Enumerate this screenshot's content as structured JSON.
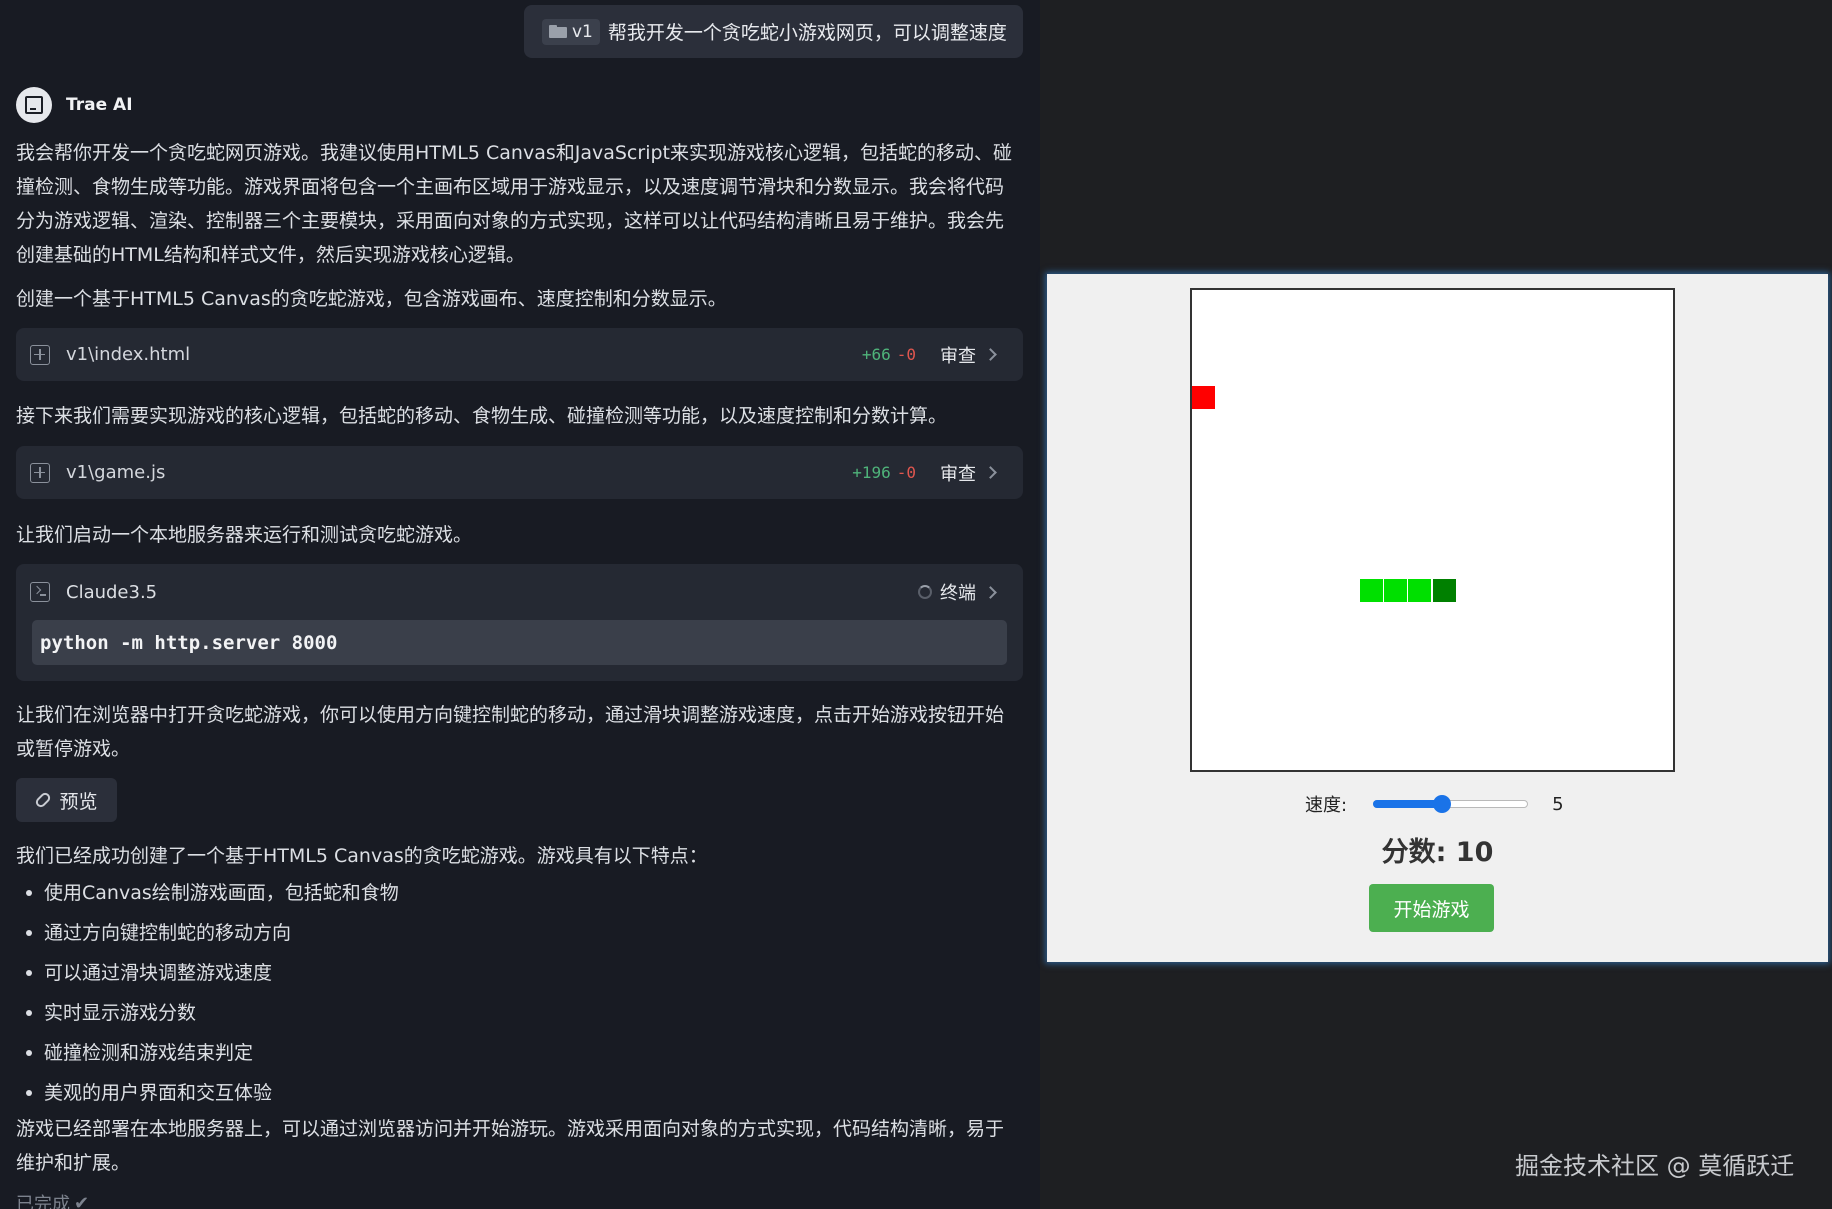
{
  "user_message": {
    "context_chip": "v1",
    "text": "帮我开发一个贪吃蛇小游戏网页，可以调整速度"
  },
  "assistant": {
    "name": "Trae AI",
    "intro": "我会帮你开发一个贪吃蛇网页游戏。我建议使用HTML5 Canvas和JavaScript来实现游戏核心逻辑，包括蛇的移动、碰撞检测、食物生成等功能。游戏界面将包含一个主画布区域用于游戏显示，以及速度调节滑块和分数显示。我会将代码分为游戏逻辑、渲染、控制器三个主要模块，采用面向对象的方式实现，这样可以让代码结构清晰且易于维护。我会先创建基础的HTML结构和样式文件，然后实现游戏核心逻辑。",
    "step1": "创建一个基于HTML5 Canvas的贪吃蛇游戏，包含游戏画布、速度控制和分数显示。",
    "step2": "接下来我们需要实现游戏的核心逻辑，包括蛇的移动、食物生成、碰撞检测等功能，以及速度控制和分数计算。",
    "step3": "让我们启动一个本地服务器来运行和测试贪吃蛇游戏。",
    "step4": "让我们在浏览器中打开贪吃蛇游戏，你可以使用方向键控制蛇的移动，通过滑块调整游戏速度，点击开始游戏按钮开始或暂停游戏。",
    "summary": "我们已经成功创建了一个基于HTML5 Canvas的贪吃蛇游戏。游戏具有以下特点：",
    "features": [
      "使用Canvas绘制游戏画面，包括蛇和食物",
      "通过方向键控制蛇的移动方向",
      "可以通过滑块调整游戏速度",
      "实时显示游戏分数",
      "碰撞检测和游戏结束判定",
      "美观的用户界面和交互体验"
    ],
    "closing": "游戏已经部署在本地服务器上，可以通过浏览器访问并开始游玩。游戏采用面向对象的方式实现，代码结构清晰，易于维护和扩展。",
    "done_label": "已完成"
  },
  "files": [
    {
      "name": "v1\\index.html",
      "added": "+66",
      "removed": "-0",
      "action": "审查"
    },
    {
      "name": "v1\\game.js",
      "added": "+196",
      "removed": "-0",
      "action": "审查"
    }
  ],
  "terminal": {
    "model": "Claude3.5",
    "action": "终端",
    "command": "python -m http.server 8000"
  },
  "preview_button": "预览",
  "game": {
    "speed_label": "速度:",
    "speed_value": "5",
    "speed_min": 1,
    "speed_max": 10,
    "score_text": "分数: 10",
    "start_label": "开始游戏",
    "grid_size": 20,
    "food": {
      "col": 0,
      "row": 4
    },
    "snake": [
      {
        "col": 10,
        "row": 12,
        "head": true
      },
      {
        "col": 9,
        "row": 12
      },
      {
        "col": 8,
        "row": 12
      },
      {
        "col": 7,
        "row": 12
      }
    ],
    "colors": {
      "food": "#ff0000",
      "snake_body": "#00e000",
      "snake_head": "#008000"
    }
  },
  "watermark": "掘金技术社区 @ 莫循跃迁"
}
